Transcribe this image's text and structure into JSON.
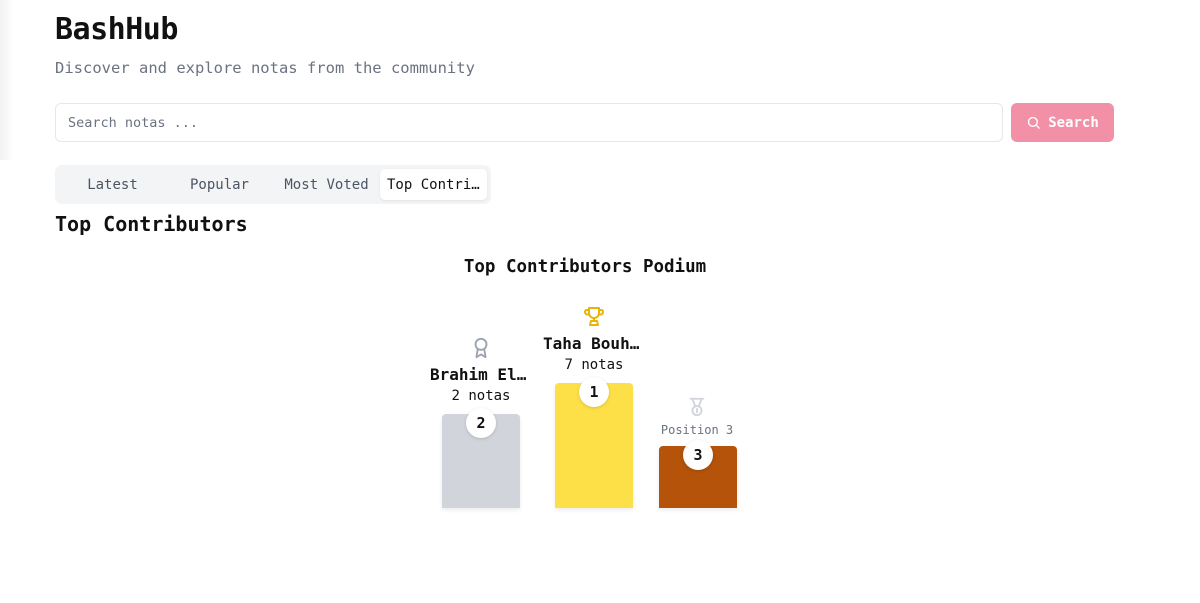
{
  "app": {
    "title": "BashHub",
    "subtitle": "Discover and explore notas from the community"
  },
  "search": {
    "placeholder": "Search notas ...",
    "value": "",
    "button_label": "Search",
    "button_icon": "search-icon",
    "button_color": "#f190a6"
  },
  "tabs": [
    {
      "label": "Latest",
      "active": false
    },
    {
      "label": "Popular",
      "active": false
    },
    {
      "label": "Most Voted",
      "active": false
    },
    {
      "label": "Top Contributors",
      "active": true
    }
  ],
  "section_title": "Top Contributors",
  "podium": {
    "title": "Top Contributors Podium",
    "places": [
      {
        "rank": "1",
        "name": "Taha Bouhsine",
        "count": "7 notas",
        "icon": "trophy-icon",
        "color": "#fde047",
        "icon_color": "#eab308"
      },
      {
        "rank": "2",
        "name": "Brahim El Hamdaoui",
        "count": "2 notas",
        "icon": "award-ribbon-icon",
        "color": "#d1d5db",
        "icon_color": "#9ca3af"
      },
      {
        "rank": "3",
        "label": "Position 3",
        "icon": "medal-icon",
        "color": "#b45309",
        "icon_color": "#d1d5db"
      }
    ]
  }
}
